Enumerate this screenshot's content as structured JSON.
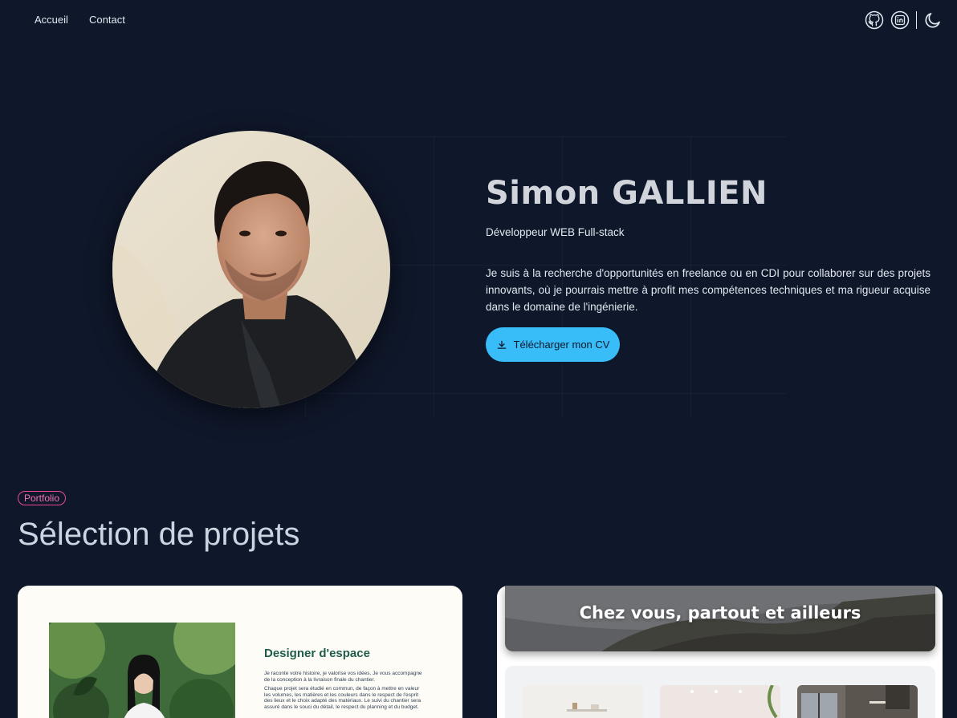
{
  "nav": {
    "links": [
      {
        "label": "Accueil"
      },
      {
        "label": "Contact"
      }
    ],
    "icons": [
      "github-icon",
      "linkedin-icon",
      "moon-icon"
    ]
  },
  "hero": {
    "name": "Simon GALLIEN",
    "role": "Développeur WEB Full-stack",
    "description": "Je suis à la recherche d'opportunités en freelance ou en CDI pour collaborer sur des projets innovants, où je pourrais mettre à profit mes compétences techniques et ma rigueur acquise dans le domaine de l'ingénierie.",
    "cv_button": "Télécharger mon CV"
  },
  "portfolio": {
    "badge": "Portfolio",
    "title": "Sélection de projets",
    "projects": [
      {
        "heading": "Designer d'espace",
        "paragraphs": [
          "Je raconte votre histoire, je valorise vos idées. Je vous accompagne de la conception à la livraison finale du chantier.",
          "Chaque projet sera étudié en commun, de façon à mettre en valeur les volumes, les matières et les couleurs dans le respect de l'esprit des lieux et le choix adapté des matériaux. Le suivi du chantier sera assuré dans le souci du détail, le respect du planning et du budget."
        ]
      },
      {
        "heading": "Chez vous, partout et ailleurs"
      }
    ]
  },
  "colors": {
    "background": "#0f172a",
    "accent": "#38bdf8",
    "badge": "#ec4899"
  }
}
